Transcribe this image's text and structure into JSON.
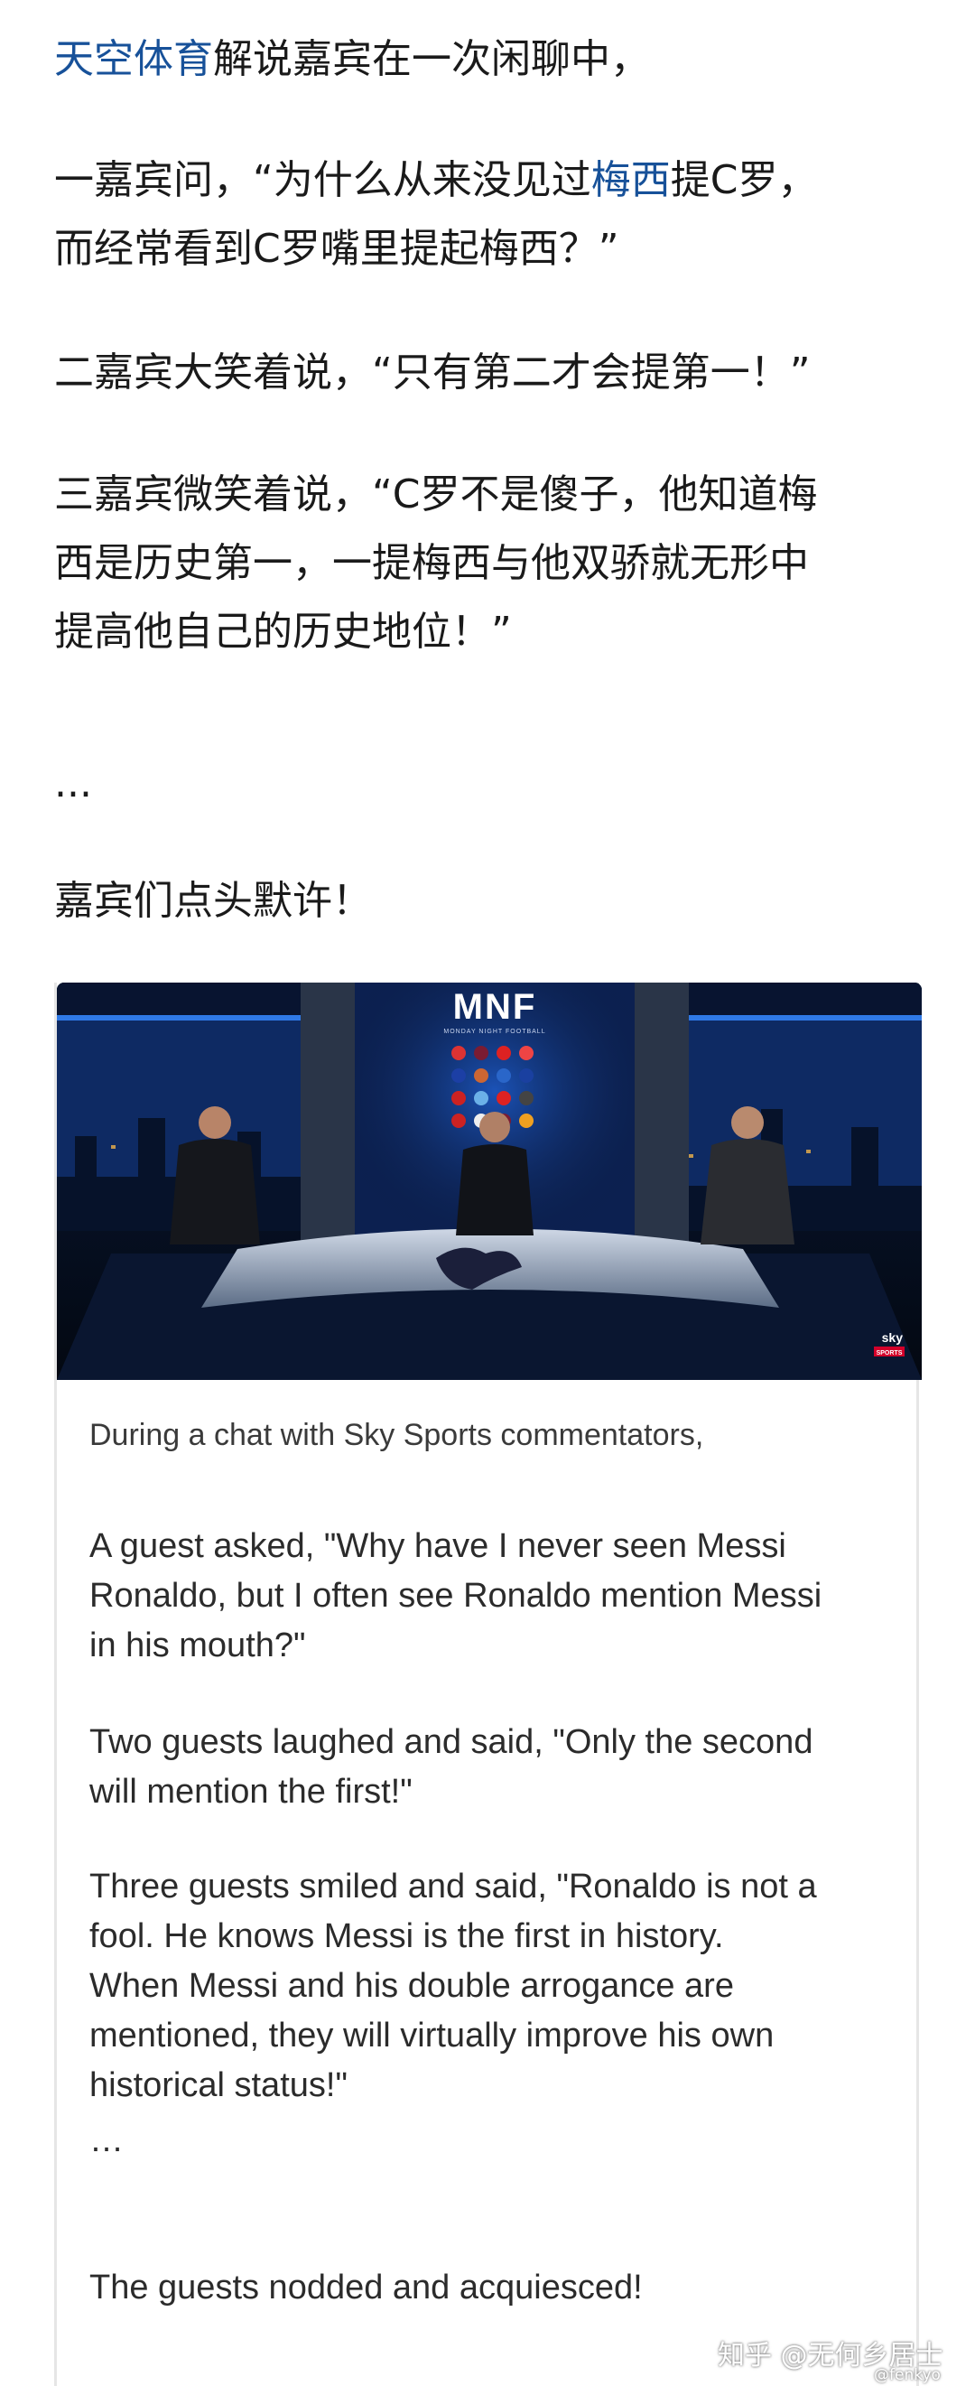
{
  "article": {
    "line1": {
      "link": "天空体育",
      "rest": "解说嘉宾在一次闲聊中，"
    },
    "para1": {
      "pre": "一嘉宾问，“为什么从来没见过",
      "link": "梅西",
      "mid": "提C罗，",
      "line2": "而经常看到C罗嘴里提起梅西？”"
    },
    "para2": "二嘉宾大笑着说，“只有第二才会提第一！”",
    "para3": {
      "l1": "三嘉宾微笑着说，“C罗不是傻子，他知道梅",
      "l2": "西是历史第一，一提梅西与他双骄就无形中",
      "l3": "提高他自己的历史地位！”"
    },
    "ellipsis": "...",
    "closing": "嘉宾们点头默许！"
  },
  "video": {
    "logo": "MNF",
    "logo_sub": "MONDAY NIGHT FOOTBALL",
    "channel": "sky",
    "channel_sub": "SPORTS"
  },
  "translation": {
    "caption": "During a chat with Sky Sports commentators,",
    "p1": [
      "A guest asked, \"Why have I never seen Messi",
      "Ronaldo, but I often see Ronaldo mention Messi",
      "in his mouth?\""
    ],
    "p2": [
      "Two guests laughed and said, \"Only the second",
      "will mention the first!\""
    ],
    "p3": [
      "Three guests smiled and said, \"Ronaldo is not a",
      "fool. He knows Messi is the first in history.",
      "When Messi and his double arrogance are",
      "mentioned, they will virtually improve his own",
      "historical status!\""
    ],
    "ellipsis": "…",
    "closing": "The guests nodded and acquiesced!"
  },
  "watermark": {
    "zhihu": "知乎 @无何乡居士",
    "handle": "@fenkyo"
  }
}
